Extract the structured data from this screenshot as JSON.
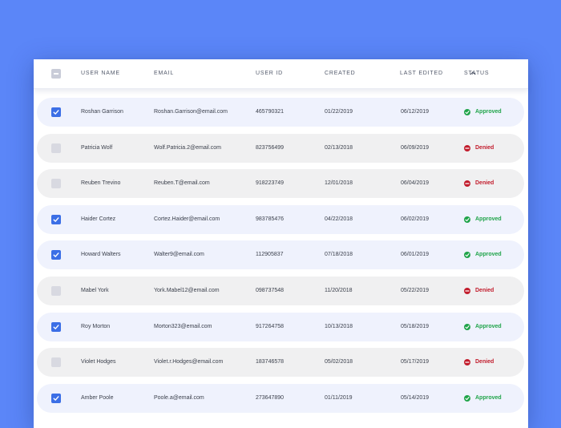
{
  "header": {
    "select_all_state": "indeterminate",
    "columns": [
      "USER NAME",
      "EMAIL",
      "USER ID",
      "CREATED",
      "LAST EDITED",
      "STATUS"
    ],
    "sort_icon": "chevron-up-icon"
  },
  "colors": {
    "background": "#5b86f8",
    "checkbox_checked": "#3c6fe6",
    "approved": "#20a44a",
    "denied": "#c21d2d",
    "row_approved": "#eff2fd",
    "row_denied": "#f0f0f1"
  },
  "rows": [
    {
      "checked": true,
      "name": "Roshan Garrison",
      "email": "Roshan.Garrison@email.com",
      "user_id": "465790321",
      "created": "01/22/2019",
      "last_edited": "06/12/2019",
      "status": "Approved"
    },
    {
      "checked": false,
      "name": "Patricia Wolf",
      "email": "Wolf.Patricia.2@email.com",
      "user_id": "823756499",
      "created": "02/13/2018",
      "last_edited": "06/09/2019",
      "status": "Denied"
    },
    {
      "checked": false,
      "name": "Reuben Trevino",
      "email": "Reuben.T@email.com",
      "user_id": "918223749",
      "created": "12/01/2018",
      "last_edited": "06/04/2019",
      "status": "Denied"
    },
    {
      "checked": true,
      "name": "Haider Cortez",
      "email": "Cortez.Haider@email.com",
      "user_id": "983785476",
      "created": "04/22/2018",
      "last_edited": "06/02/2019",
      "status": "Approved"
    },
    {
      "checked": true,
      "name": "Howard Walters",
      "email": "Walter9@email.com",
      "user_id": "112905837",
      "created": "07/18/2018",
      "last_edited": "06/01/2019",
      "status": "Approved"
    },
    {
      "checked": false,
      "name": "Mabel York",
      "email": "York.Mabel12@email.com",
      "user_id": "098737548",
      "created": "11/20/2018",
      "last_edited": "05/22/2019",
      "status": "Denied"
    },
    {
      "checked": true,
      "name": "Roy Morton",
      "email": "Morton323@email.com",
      "user_id": "917264758",
      "created": "10/13/2018",
      "last_edited": "05/18/2019",
      "status": "Approved"
    },
    {
      "checked": false,
      "name": "Violet Hodges",
      "email": "Violet.r.Hodges@email.com",
      "user_id": "183746578",
      "created": "05/02/2018",
      "last_edited": "05/17/2019",
      "status": "Denied"
    },
    {
      "checked": true,
      "name": "Amber Poole",
      "email": "Poole.a@email.com",
      "user_id": "273647890",
      "created": "01/11/2019",
      "last_edited": "05/14/2019",
      "status": "Approved"
    }
  ]
}
